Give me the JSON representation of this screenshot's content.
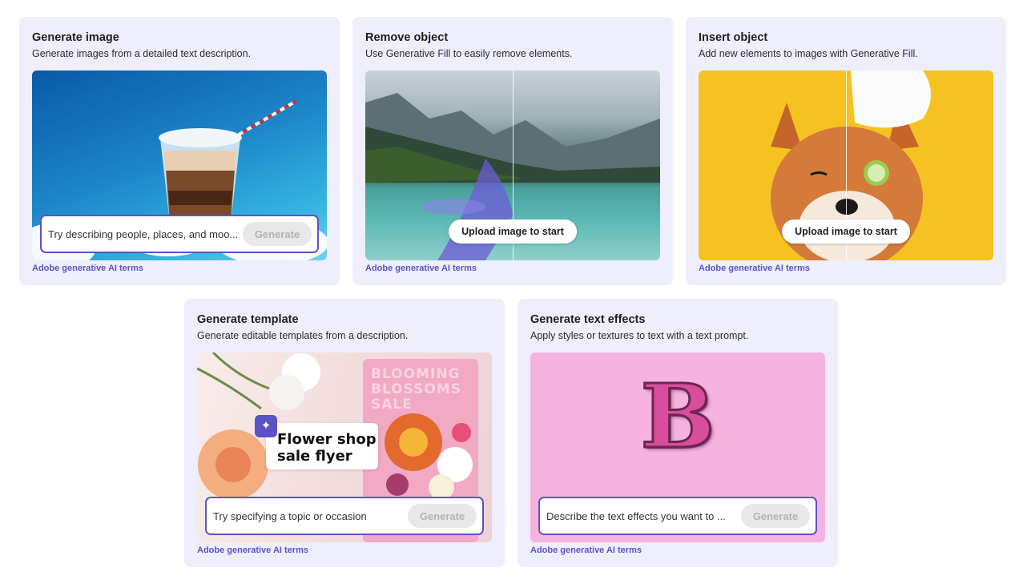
{
  "cards": [
    {
      "title": "Generate image",
      "description": "Generate images from a detailed text description.",
      "prompt_placeholder": "Try describing people, places, and moo...",
      "button": "Generate",
      "terms": "Adobe generative AI terms"
    },
    {
      "title": "Remove object",
      "description": "Use Generative Fill to easily remove elements.",
      "button": "Upload image to start",
      "terms": "Adobe generative AI terms"
    },
    {
      "title": "Insert object",
      "description": "Add new elements to images with Generative Fill.",
      "button": "Upload image to start",
      "terms": "Adobe generative AI terms"
    },
    {
      "title": "Generate template",
      "description": "Generate editable templates from a description.",
      "prompt_placeholder": "Try specifying a topic or occasion",
      "button": "Generate",
      "terms": "Adobe generative AI terms",
      "overlay_text_line1": "Flower shop",
      "overlay_text_line2": "sale flyer",
      "flyer_text": "BLOOMING BLOSSOMS SALE"
    },
    {
      "title": "Generate text effects",
      "description": "Apply styles or textures to text with a text prompt.",
      "prompt_placeholder": "Describe the text effects you want to ...",
      "button": "Generate",
      "terms": "Adobe generative AI terms",
      "effect_letter": "B"
    }
  ],
  "colors": {
    "card_bg": "#eeeefc",
    "accent": "#5c52c8",
    "link": "#5a55c8"
  }
}
